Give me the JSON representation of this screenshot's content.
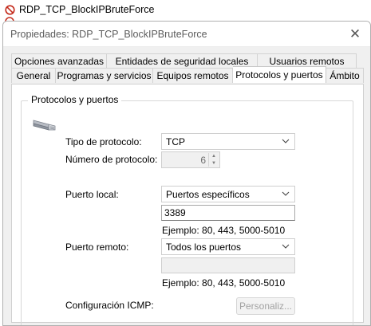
{
  "background_rule": {
    "name": "RDP_TCP_BlockIPBruteForce",
    "icon": "block-icon"
  },
  "dialog": {
    "title": "Propiedades: RDP_TCP_BlockIPBruteForce",
    "close_label": "✕"
  },
  "tabs": {
    "top_row": [
      "Opciones avanzadas",
      "Entidades de seguridad locales",
      "Usuarios remotos"
    ],
    "bottom_row": [
      "General",
      "Programas y servicios",
      "Equipos remotos",
      "Protocolos y puertos",
      "Ámbito"
    ],
    "active": "Protocolos y puertos"
  },
  "group": {
    "legend": "Protocolos y puertos",
    "icon": "network-plug-icon"
  },
  "protocol": {
    "type_label": "Tipo de protocolo:",
    "type_value": "TCP",
    "number_label": "Número de protocolo:",
    "number_value": "6"
  },
  "local_port": {
    "label": "Puerto local:",
    "mode_value": "Puertos específicos",
    "ports_value": "3389",
    "example": "Ejemplo: 80, 443, 5000-5010"
  },
  "remote_port": {
    "label": "Puerto remoto:",
    "mode_value": "Todos los puertos",
    "ports_value": "",
    "example": "Ejemplo: 80, 443, 5000-5010"
  },
  "icmp": {
    "label": "Configuración ICMP:",
    "button_label": "Personaliz..."
  },
  "colors": {
    "dialog_bg": "#f0f0f0",
    "panel_bg": "#ffffff",
    "disabled_text": "#a2a2a2",
    "block_red": "#c42b1c"
  }
}
